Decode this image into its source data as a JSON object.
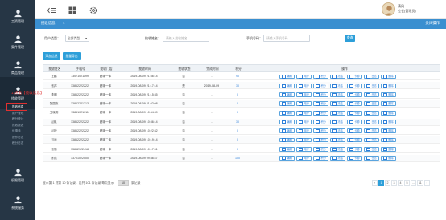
{
  "sidebar": {
    "items": [
      {
        "label": "工资管理",
        "icon": "person-icon"
      },
      {
        "label": "案件管理",
        "icon": "person-icon"
      },
      {
        "label": "商品管理",
        "icon": "person-icon"
      },
      {
        "label": "揽收管理",
        "icon": "person-icon"
      },
      {
        "label": "权限管理",
        "icon": "person-icon"
      },
      {
        "label": "系统服务",
        "icon": "person-icon"
      }
    ],
    "submenu": [
      "揽收信息",
      "用户管理",
      "积分统计",
      "揽收报表",
      "优惠券",
      "操作日志",
      "积分日志"
    ]
  },
  "header": {
    "user_name": "清风",
    "user_role": "会长(管理员)"
  },
  "tabbar": {
    "active_tab": "揽收信息",
    "close": "×",
    "ops": "关闭操作"
  },
  "filters": {
    "type_label": "用户类型：",
    "type_value": "全部类型",
    "name_label": "揽收姓名：",
    "name_placeholder": "请输入揽收姓名",
    "phone_label": "手机号码：",
    "phone_placeholder": "请输入手机号码",
    "search_button": "查询"
  },
  "actions": {
    "add": "添加信息",
    "export": "批量导出"
  },
  "annotation": "1.点击【揽收信息】",
  "table": {
    "columns": [
      "揽收姓名",
      "手机号",
      "揽收门店",
      "揽收时间",
      "揽收状态",
      "完成时间",
      "积分",
      "操作"
    ],
    "ops": [
      "编辑",
      "用户",
      "积分",
      "冻结",
      "卡券",
      "日志",
      "删除"
    ],
    "rows": [
      {
        "name": "王鹏",
        "phone": "13071021199",
        "store": "跨境一体",
        "time": "2019-08-09 21:36:14",
        "status": "否",
        "done": "-",
        "points": "90"
      },
      {
        "name": "张邦",
        "phone": "13862222222",
        "store": "跨境一体",
        "time": "2019-08-09 21:17:14",
        "status": "是",
        "done": "2019-08-09",
        "points": "30"
      },
      {
        "name": "李明",
        "phone": "13862222222",
        "store": "跨境一体",
        "time": "2019-08-09 21:15:35",
        "status": "否",
        "done": "-",
        "points": "0"
      },
      {
        "name": "张国栋",
        "phone": "13862221213",
        "store": "跨境一体",
        "time": "2019-08-09 21:02:08",
        "status": "否",
        "done": "-",
        "points": "0"
      },
      {
        "name": "王晓明",
        "phone": "13861021011",
        "store": "跨境一体",
        "time": "2019-08-09 10:54:39",
        "status": "否",
        "done": "-",
        "points": "0"
      },
      {
        "name": "赵帆",
        "phone": "13862222222",
        "store": "跨境一体",
        "time": "2019-08-09 10:36:14",
        "status": "否",
        "done": "-",
        "points": "30"
      },
      {
        "name": "赵锐",
        "phone": "13862222222",
        "store": "跨境一体",
        "time": "2019-08-09 10:22:32",
        "status": "否",
        "done": "-",
        "points": "0"
      },
      {
        "name": "刘涛",
        "phone": "13862222222",
        "store": "跨境二体",
        "time": "2019-08-09 10:19:14",
        "status": "否",
        "done": "-",
        "points": "0"
      },
      {
        "name": "张丽",
        "phone": "13862122418",
        "store": "跨境一体",
        "time": "2019-08-09 10:17:51",
        "status": "否",
        "done": "-",
        "points": "0"
      },
      {
        "name": "陈燕",
        "phone": "13701022000",
        "store": "跨境一体",
        "time": "2019-08-09 09:46:47",
        "status": "否",
        "done": "-",
        "points": "100"
      }
    ]
  },
  "footer": {
    "summary": "显示第 1 到第 10 条记录，总共 101 条记录 每页显示",
    "page_size": "10",
    "tail": "条记录",
    "pages": [
      "‹",
      "1",
      "2",
      "3",
      "4",
      "5",
      "...",
      "11",
      "›"
    ],
    "active_page": "1"
  },
  "colors": {
    "sidebar": "#263645",
    "accent": "#2d9fd9",
    "tabbar": "#3a8fd0",
    "annotation": "#e03030"
  }
}
